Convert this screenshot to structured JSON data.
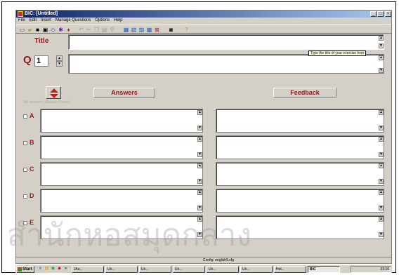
{
  "window": {
    "title": "BIC: [Untitled]",
    "minimize_icon": "minimize-icon",
    "maximize_icon": "maximize-icon",
    "close_icon": "close-icon"
  },
  "menu": [
    "File",
    "Edit",
    "Insert",
    "Manage Questions",
    "Options",
    "Help"
  ],
  "form": {
    "title_label": "Title",
    "title_value": "",
    "tooltip": "Type the title of your exercise here",
    "q_label": "Q",
    "q_number": "1",
    "answers_header": "Answers",
    "feedback_header": "Feedback",
    "faint_option": "Mix answers (Multiple Choice)"
  },
  "answers": [
    {
      "letter": "A",
      "checked": false
    },
    {
      "letter": "B",
      "checked": false
    },
    {
      "letter": "C",
      "checked": false
    },
    {
      "letter": "D",
      "checked": false
    },
    {
      "letter": "E",
      "checked": false
    }
  ],
  "status": {
    "config": "Config: english5.cfg"
  },
  "taskbar": {
    "start": "Start",
    "tasks": [
      "JAe...",
      "Un...",
      "Un...",
      "Un...",
      "Un...",
      "Un...",
      "Hot...",
      "BIC"
    ],
    "clock": "23:16"
  },
  "watermark_text": "สำนักหอสมุดกลาง"
}
